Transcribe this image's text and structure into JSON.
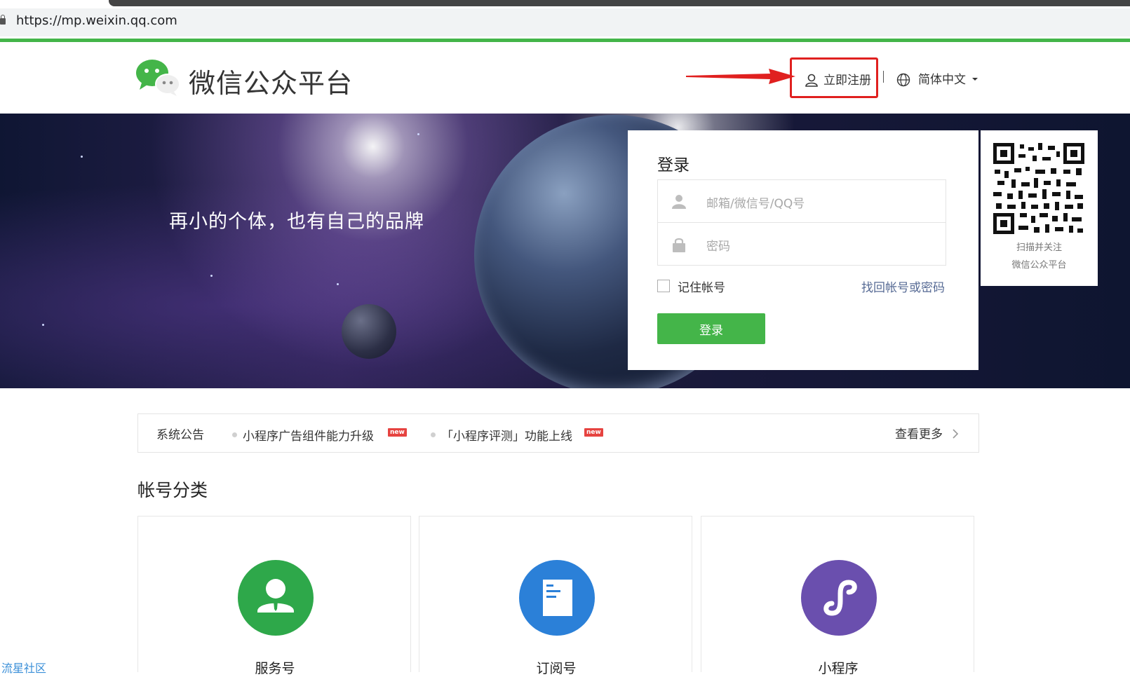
{
  "browser": {
    "url": "https://mp.weixin.qq.com"
  },
  "header": {
    "brand": "微信公众平台",
    "register_label": "立即注册",
    "language": "简体中文"
  },
  "banner": {
    "slogan": "再小的个体，也有自己的品牌"
  },
  "login": {
    "title": "登录",
    "account_placeholder": "邮箱/微信号/QQ号",
    "password_placeholder": "密码",
    "remember_label": "记住帐号",
    "forgot_label": "找回帐号或密码",
    "submit_label": "登录"
  },
  "qr": {
    "line1": "扫描并关注",
    "line2": "微信公众平台"
  },
  "notice": {
    "title": "系统公告",
    "items": [
      {
        "text": "小程序广告组件能力升级",
        "badge": "new"
      },
      {
        "text": "「小程序评测」功能上线",
        "badge": "new"
      }
    ],
    "more_label": "查看更多"
  },
  "accounts": {
    "title": "帐号分类",
    "items": [
      {
        "label": "服务号",
        "icon": "service-account-icon",
        "color": "#2ea84a"
      },
      {
        "label": "订阅号",
        "icon": "subscription-account-icon",
        "color": "#2b80d8"
      },
      {
        "label": "小程序",
        "icon": "mini-program-icon",
        "color": "#6a4fae"
      }
    ]
  },
  "watermark": "流星社区",
  "colors": {
    "brand_green": "#44b549",
    "highlight_red": "#e0201f",
    "link_blue": "#576b95"
  }
}
